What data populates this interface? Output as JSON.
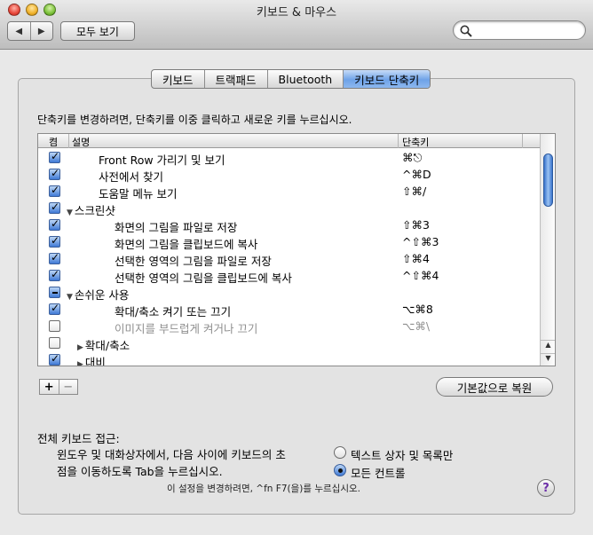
{
  "window": {
    "title": "키보드 & 마우스"
  },
  "toolbar": {
    "back_icon": "back-arrow-icon",
    "forward_icon": "forward-arrow-icon",
    "show_all_label": "모두 보기",
    "search_value": "",
    "search_icon": "magnifier-icon"
  },
  "tabs": [
    {
      "label": "키보드",
      "active": false
    },
    {
      "label": "트랙패드",
      "active": false
    },
    {
      "label": "Bluetooth",
      "active": false
    },
    {
      "label": "키보드 단축키",
      "active": true
    }
  ],
  "instructions": "단축키를 변경하려면, 단축키를 이중 클릭하고 새로운 키를 누르십시오.",
  "table": {
    "columns": {
      "on": "켬",
      "description": "설명",
      "shortcut": "단축키"
    },
    "rows": [
      {
        "state": "on",
        "indent": 1,
        "triangle": "",
        "name": "Front Row 가리기 및 보기",
        "key": "⌘⎋",
        "dim": false
      },
      {
        "state": "on",
        "indent": 1,
        "triangle": "",
        "name": "사전에서 찾기",
        "key": "^⌘D",
        "dim": false
      },
      {
        "state": "on",
        "indent": 1,
        "triangle": "",
        "name": "도움말 메뉴 보기",
        "key": "⇧⌘/",
        "dim": false
      },
      {
        "state": "on",
        "indent": 0,
        "triangle": "▼",
        "name": "스크린샷",
        "key": "",
        "dim": false
      },
      {
        "state": "on",
        "indent": 2,
        "triangle": "",
        "name": "화면의 그림을 파일로 저장",
        "key": "⇧⌘3",
        "dim": false
      },
      {
        "state": "on",
        "indent": 2,
        "triangle": "",
        "name": "화면의 그림을 클립보드에 복사",
        "key": "^⇧⌘3",
        "dim": false
      },
      {
        "state": "on",
        "indent": 2,
        "triangle": "",
        "name": "선택한 영역의 그림을 파일로 저장",
        "key": "⇧⌘4",
        "dim": false
      },
      {
        "state": "on",
        "indent": 2,
        "triangle": "",
        "name": "선택한 영역의 그림을 클립보드에 복사",
        "key": "^⇧⌘4",
        "dim": false
      },
      {
        "state": "mixed",
        "indent": 0,
        "triangle": "▼",
        "name": "손쉬운 사용",
        "key": "",
        "dim": false
      },
      {
        "state": "on",
        "indent": 2,
        "triangle": "",
        "name": "확대/축소 켜기 또는 끄기",
        "key": "⌥⌘8",
        "dim": false
      },
      {
        "state": "off",
        "indent": 2,
        "triangle": "",
        "name": "이미지를 부드럽게 켜거나 끄기",
        "key": "⌥⌘\\",
        "dim": true
      },
      {
        "state": "off",
        "indent": 1,
        "triangle": "▶",
        "name": "확대/축소",
        "key": "",
        "dim": false
      },
      {
        "state": "on",
        "indent": 1,
        "triangle": "▶",
        "name": "대비",
        "key": "",
        "dim": false
      }
    ]
  },
  "buttons": {
    "add": "+",
    "remove": "−",
    "restore": "기본값으로 복원"
  },
  "full_keyboard": {
    "title": "전체 키보드 접근:",
    "description": "윈도우 및 대화상자에서, 다음 사이에 키보드의 초점을 이동하도록 Tab을 누르십시오.",
    "desc_line1": "윈도우 및 대화상자에서, 다음 사이에 키보드의 초",
    "desc_line2": "점을 이동하도록 Tab을 누르십시오.",
    "options": [
      {
        "label": "텍스트 상자 및 목록만",
        "selected": false
      },
      {
        "label": "모든 컨트롤",
        "selected": true
      }
    ],
    "note": "이 설정을 변경하려면, ^fn F7(을)를 누르십시오."
  },
  "help_label": "?"
}
